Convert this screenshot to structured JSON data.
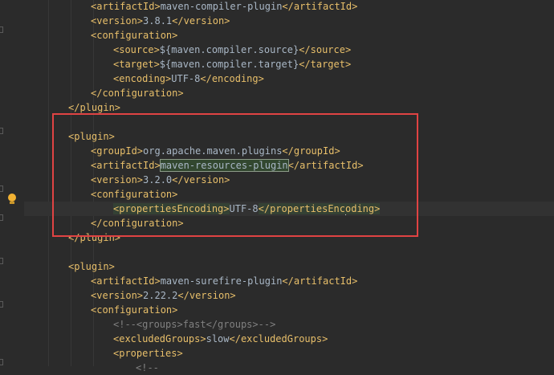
{
  "editor": {
    "lines": [
      {
        "indent": 2,
        "parts": [
          [
            "tag",
            "<artifactId>"
          ],
          [
            "txt",
            "maven-compiler-plugin"
          ],
          [
            "tag",
            "</artifactId>"
          ]
        ]
      },
      {
        "indent": 2,
        "parts": [
          [
            "tag",
            "<version>"
          ],
          [
            "txt",
            "3.8.1"
          ],
          [
            "tag",
            "</version>"
          ]
        ]
      },
      {
        "indent": 2,
        "parts": [
          [
            "tag",
            "<configuration>"
          ]
        ]
      },
      {
        "indent": 3,
        "parts": [
          [
            "tag",
            "<source>"
          ],
          [
            "txt",
            "${maven.compiler.source}"
          ],
          [
            "tag",
            "</source>"
          ]
        ]
      },
      {
        "indent": 3,
        "parts": [
          [
            "tag",
            "<target>"
          ],
          [
            "txt",
            "${maven.compiler.target}"
          ],
          [
            "tag",
            "</target>"
          ]
        ]
      },
      {
        "indent": 3,
        "parts": [
          [
            "tag",
            "<encoding>"
          ],
          [
            "txt",
            "UTF-8"
          ],
          [
            "tag",
            "</encoding>"
          ]
        ]
      },
      {
        "indent": 2,
        "parts": [
          [
            "tag",
            "</configuration>"
          ]
        ]
      },
      {
        "indent": 1,
        "parts": [
          [
            "tag",
            "</plugin>"
          ]
        ]
      },
      {
        "indent": 0,
        "parts": []
      },
      {
        "indent": 1,
        "parts": [
          [
            "tag",
            "<plugin>"
          ]
        ]
      },
      {
        "indent": 2,
        "parts": [
          [
            "tag",
            "<groupId>"
          ],
          [
            "txt",
            "org.apache.maven.plugins"
          ],
          [
            "tag",
            "</groupId>"
          ]
        ]
      },
      {
        "indent": 2,
        "parts": [
          [
            "tag",
            "<artifactId>"
          ],
          [
            "box",
            "maven-resources-plugin"
          ],
          [
            "tag",
            "</artifactId>"
          ]
        ]
      },
      {
        "indent": 2,
        "parts": [
          [
            "tag",
            "<version>"
          ],
          [
            "txt",
            "3.2.0"
          ],
          [
            "tag",
            "</version>"
          ]
        ]
      },
      {
        "indent": 2,
        "parts": [
          [
            "tag",
            "<configuration>"
          ]
        ]
      },
      {
        "indent": 3,
        "caret": true,
        "parts": [
          [
            "hltag",
            "<propertiesEncoding>"
          ],
          [
            "txt",
            "UTF-8"
          ],
          [
            "hltag",
            "</propertiesEnc"
          ],
          [
            "caret",
            ""
          ],
          [
            "hltag",
            "oding>"
          ]
        ]
      },
      {
        "indent": 2,
        "parts": [
          [
            "tag",
            "</configuration>"
          ]
        ]
      },
      {
        "indent": 1,
        "parts": [
          [
            "tag",
            "</plugin>"
          ]
        ]
      },
      {
        "indent": 0,
        "parts": []
      },
      {
        "indent": 1,
        "parts": [
          [
            "tag",
            "<plugin>"
          ]
        ]
      },
      {
        "indent": 2,
        "parts": [
          [
            "tag",
            "<artifactId>"
          ],
          [
            "txt",
            "maven-surefire-plugin"
          ],
          [
            "tag",
            "</artifactId>"
          ]
        ]
      },
      {
        "indent": 2,
        "parts": [
          [
            "tag",
            "<version>"
          ],
          [
            "txt",
            "2.22.2"
          ],
          [
            "tag",
            "</version>"
          ]
        ]
      },
      {
        "indent": 2,
        "parts": [
          [
            "tag",
            "<configuration>"
          ]
        ]
      },
      {
        "indent": 3,
        "parts": [
          [
            "cmt",
            "<!--<groups>fast</groups>-->"
          ]
        ]
      },
      {
        "indent": 3,
        "parts": [
          [
            "tag",
            "<excludedGroups>"
          ],
          [
            "txt",
            "slow"
          ],
          [
            "tag",
            "</excludedGroups>"
          ]
        ]
      },
      {
        "indent": 3,
        "parts": [
          [
            "tag",
            "<properties>"
          ]
        ]
      },
      {
        "indent": 4,
        "parts": [
          [
            "cmt",
            "<!--"
          ]
        ]
      }
    ]
  }
}
